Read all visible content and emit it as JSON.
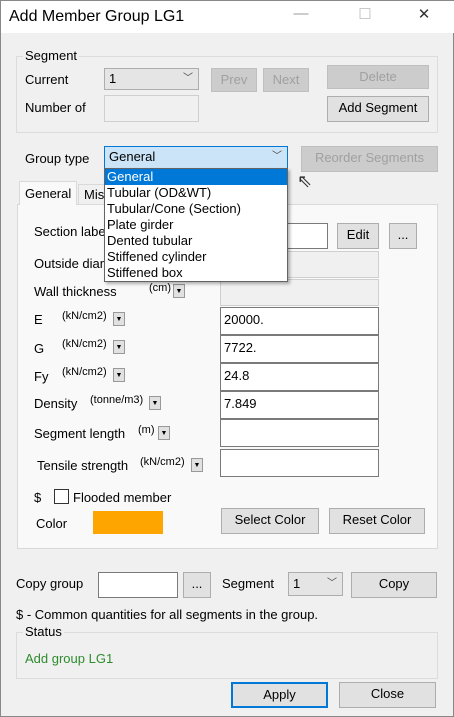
{
  "window": {
    "title": "Add Member Group LG1",
    "minimize": "—",
    "maximize": "☐",
    "close": "✕"
  },
  "segment": {
    "group_label": "Segment",
    "current_label": "Current",
    "current_value": "1",
    "prev": "Prev",
    "next": "Next",
    "delete": "Delete",
    "number_of_label": "Number of",
    "add_segment": "Add Segment"
  },
  "group_type": {
    "label": "Group type",
    "value": "General",
    "reorder": "Reorder Segments",
    "options": [
      "General",
      "Tubular (OD&WT)",
      "Tubular/Cone (Section)",
      "Plate girder",
      "Dented tubular",
      "Stiffened cylinder",
      "Stiffened box"
    ]
  },
  "tabs": [
    "General",
    "Mis"
  ],
  "form": {
    "section_label": "Section label",
    "edit": "Edit",
    "browse": "...",
    "outside_diameter": "Outside diameter",
    "wall_thickness": "Wall thickness",
    "wall_unit": "(cm)",
    "e": "E",
    "e_unit": "(kN/cm2)",
    "e_value": "20000.",
    "g": "G",
    "g_unit": "(kN/cm2)",
    "g_value": "7722.",
    "fy": "Fy",
    "fy_unit": "(kN/cm2)",
    "fy_value": "24.8",
    "density": "Density",
    "density_unit": "(tonne/m3)",
    "density_value": "7.849",
    "segment_length": "Segment length",
    "segment_length_unit": "(m)",
    "tensile_strength": "Tensile strength",
    "tensile_unit": "(kN/cm2)",
    "dollar": "$",
    "flooded": "Flooded member",
    "flooded_checked": false,
    "color_label": "Color",
    "color_value": "#ffa500",
    "select_color": "Select Color",
    "reset_color": "Reset Color"
  },
  "copy": {
    "label": "Copy group",
    "browse": "...",
    "segment_label": "Segment",
    "segment_value": "1",
    "copy": "Copy"
  },
  "note": "$ - Common quantities for all segments in the group.",
  "status": {
    "label": "Status",
    "text": "Add group LG1",
    "color": "#2e8b2e"
  },
  "footer": {
    "apply": "Apply",
    "close": "Close"
  }
}
